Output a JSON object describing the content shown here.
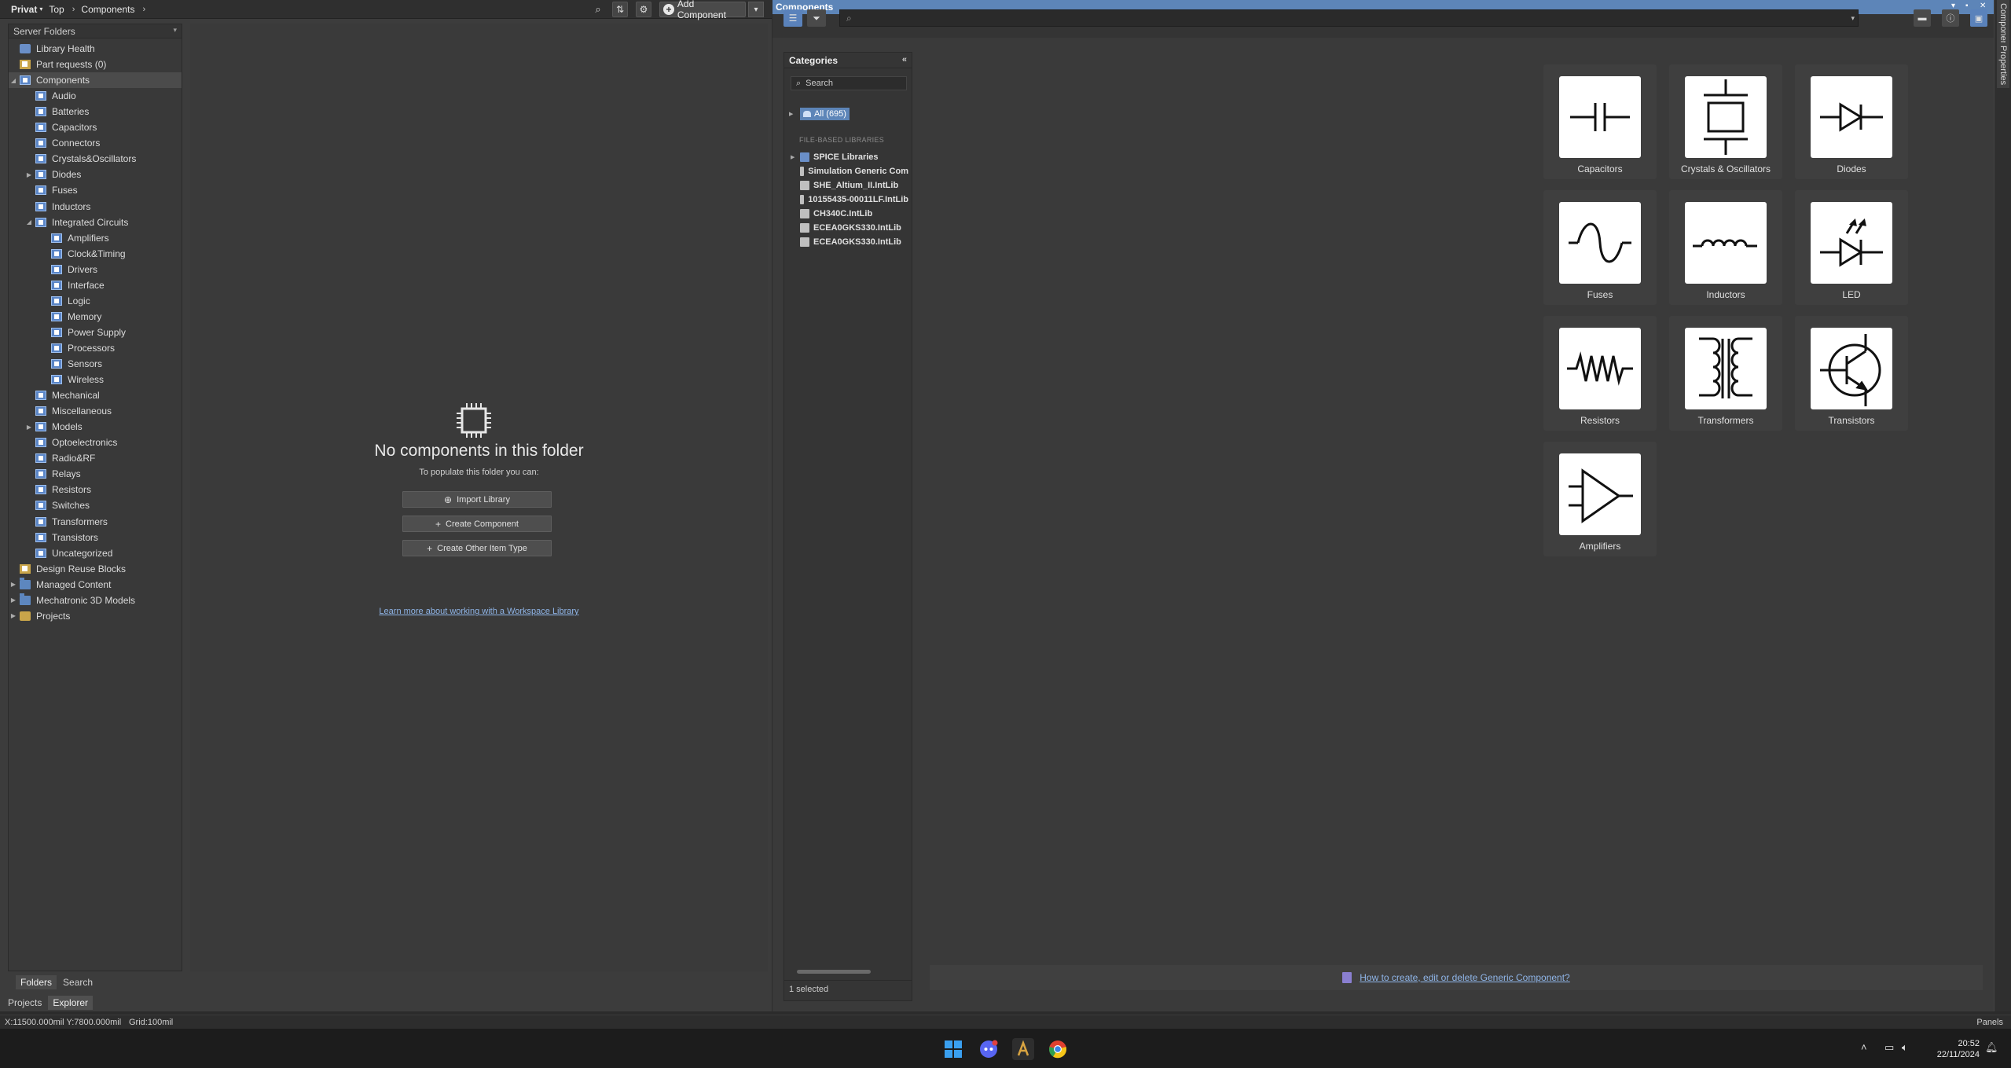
{
  "breadcrumb": {
    "root": "Privat",
    "items": [
      "Top",
      "Components"
    ]
  },
  "toolbar": {
    "add_component_label": "Add Component"
  },
  "tree": {
    "header": "Server Folders",
    "items": [
      {
        "label": "Library Health",
        "level": 1,
        "icon": "health"
      },
      {
        "label": "Part requests (0)",
        "level": 1,
        "icon": "yellow"
      },
      {
        "label": "Components",
        "level": 1,
        "icon": "comp",
        "expanded": true,
        "selected": true
      },
      {
        "label": "Audio",
        "level": 2,
        "icon": "comp"
      },
      {
        "label": "Batteries",
        "level": 2,
        "icon": "comp"
      },
      {
        "label": "Capacitors",
        "level": 2,
        "icon": "comp"
      },
      {
        "label": "Connectors",
        "level": 2,
        "icon": "comp"
      },
      {
        "label": "Crystals&Oscillators",
        "level": 2,
        "icon": "comp"
      },
      {
        "label": "Diodes",
        "level": 2,
        "icon": "comp",
        "collapsed": true
      },
      {
        "label": "Fuses",
        "level": 2,
        "icon": "comp"
      },
      {
        "label": "Inductors",
        "level": 2,
        "icon": "comp"
      },
      {
        "label": "Integrated Circuits",
        "level": 2,
        "icon": "comp",
        "expanded": true
      },
      {
        "label": "Amplifiers",
        "level": 3,
        "icon": "comp"
      },
      {
        "label": "Clock&Timing",
        "level": 3,
        "icon": "comp"
      },
      {
        "label": "Drivers",
        "level": 3,
        "icon": "comp"
      },
      {
        "label": "Interface",
        "level": 3,
        "icon": "comp"
      },
      {
        "label": "Logic",
        "level": 3,
        "icon": "comp"
      },
      {
        "label": "Memory",
        "level": 3,
        "icon": "comp"
      },
      {
        "label": "Power Supply",
        "level": 3,
        "icon": "comp"
      },
      {
        "label": "Processors",
        "level": 3,
        "icon": "comp"
      },
      {
        "label": "Sensors",
        "level": 3,
        "icon": "comp"
      },
      {
        "label": "Wireless",
        "level": 3,
        "icon": "comp"
      },
      {
        "label": "Mechanical",
        "level": 2,
        "icon": "comp"
      },
      {
        "label": "Miscellaneous",
        "level": 2,
        "icon": "comp"
      },
      {
        "label": "Models",
        "level": 2,
        "icon": "comp",
        "collapsed": true
      },
      {
        "label": "Optoelectronics",
        "level": 2,
        "icon": "comp"
      },
      {
        "label": "Radio&RF",
        "level": 2,
        "icon": "comp"
      },
      {
        "label": "Relays",
        "level": 2,
        "icon": "comp"
      },
      {
        "label": "Resistors",
        "level": 2,
        "icon": "comp"
      },
      {
        "label": "Switches",
        "level": 2,
        "icon": "comp"
      },
      {
        "label": "Transformers",
        "level": 2,
        "icon": "comp"
      },
      {
        "label": "Transistors",
        "level": 2,
        "icon": "comp"
      },
      {
        "label": "Uncategorized",
        "level": 2,
        "icon": "comp"
      },
      {
        "label": "Design Reuse Blocks",
        "level": 1,
        "icon": "yellow"
      },
      {
        "label": "Managed Content",
        "level": 1,
        "icon": "folder",
        "collapsed": true
      },
      {
        "label": "Mechatronic 3D Models",
        "level": 1,
        "icon": "folder",
        "collapsed": true
      },
      {
        "label": "Projects",
        "level": 1,
        "icon": "proj",
        "collapsed": true
      }
    ],
    "tabs": [
      "Folders",
      "Search"
    ]
  },
  "bottom_tabs": [
    "Projects",
    "Explorer"
  ],
  "empty_state": {
    "title": "No components in this folder",
    "subtitle": "To populate this folder you can:",
    "buttons": [
      "Import Library",
      "Create Component",
      "Create Other Item Type"
    ],
    "link": "Learn more about working with a Workspace Library"
  },
  "status": {
    "coords": "X:11500.000mil Y:7800.000mil",
    "grid": "Grid:100mil",
    "panels": "Panels"
  },
  "components_panel": {
    "title": "Components",
    "categories": {
      "header": "Categories",
      "search_placeholder": "Search",
      "all": "All (695)",
      "file_based_label": "FILE-BASED LIBRARIES",
      "libraries": [
        "SPICE Libraries",
        "Simulation Generic Com",
        "SHE_Altium_II.IntLib",
        "10155435-00011LF.IntLib",
        "CH340C.IntLib",
        "ECEA0GKS330.IntLib",
        "ECEA0GKS330.IntLib"
      ],
      "status": "1 selected"
    },
    "tiles": [
      {
        "label": "Capacitors",
        "icon": "capacitor-icon"
      },
      {
        "label": "Crystals & Oscillators",
        "icon": "crystal-icon"
      },
      {
        "label": "Diodes",
        "icon": "diode-icon"
      },
      {
        "label": "Fuses",
        "icon": "fuse-icon"
      },
      {
        "label": "Inductors",
        "icon": "inductor-icon"
      },
      {
        "label": "LED",
        "icon": "led-icon"
      },
      {
        "label": "Resistors",
        "icon": "resistor-icon"
      },
      {
        "label": "Transformers",
        "icon": "transformer-icon"
      },
      {
        "label": "Transistors",
        "icon": "transistor-icon"
      },
      {
        "label": "Amplifiers",
        "icon": "amplifier-icon"
      }
    ],
    "help_link": "How to create, edit or delete Generic Component?"
  },
  "side_tabs": [
    "Components",
    "Properties"
  ],
  "taskbar": {
    "time": "20:52",
    "date": "22/11/2024"
  },
  "colors": {
    "accent": "#5d85b8",
    "link": "#8fb5e8",
    "background": "#3a3a3a"
  }
}
